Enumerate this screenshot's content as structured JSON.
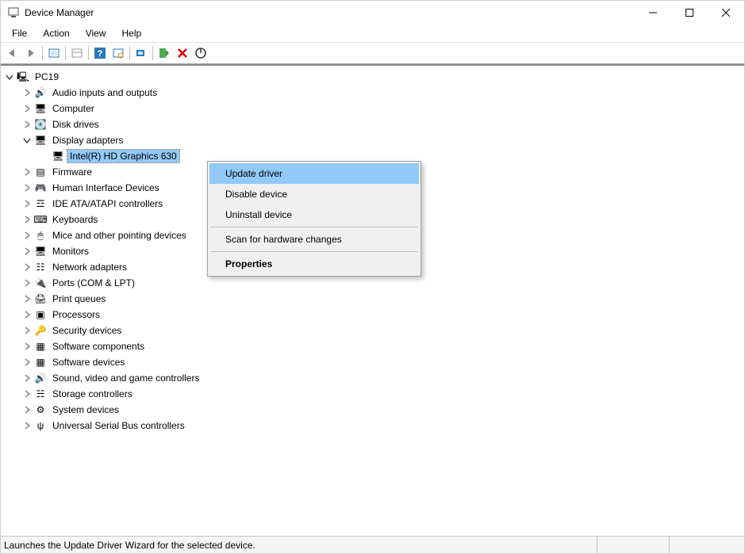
{
  "window": {
    "title": "Device Manager"
  },
  "menus": {
    "file": "File",
    "action": "Action",
    "view": "View",
    "help": "Help"
  },
  "tree": {
    "root": "PC19",
    "categories": [
      {
        "label": "Audio inputs and outputs",
        "icon": "speaker",
        "expanded": false
      },
      {
        "label": "Computer",
        "icon": "monitor",
        "expanded": false
      },
      {
        "label": "Disk drives",
        "icon": "disk",
        "expanded": false
      },
      {
        "label": "Display adapters",
        "icon": "monitor",
        "expanded": true,
        "children": [
          {
            "label": "Intel(R) HD Graphics 630",
            "icon": "monitor",
            "selected": true
          }
        ]
      },
      {
        "label": "Firmware",
        "icon": "chip",
        "expanded": false
      },
      {
        "label": "Human Interface Devices",
        "icon": "hid",
        "expanded": false
      },
      {
        "label": "IDE ATA/ATAPI controllers",
        "icon": "ide",
        "expanded": false
      },
      {
        "label": "Keyboards",
        "icon": "keyboard",
        "expanded": false
      },
      {
        "label": "Mice and other pointing devices",
        "icon": "mouse",
        "expanded": false
      },
      {
        "label": "Monitors",
        "icon": "monitor",
        "expanded": false
      },
      {
        "label": "Network adapters",
        "icon": "network",
        "expanded": false
      },
      {
        "label": "Ports (COM & LPT)",
        "icon": "port",
        "expanded": false
      },
      {
        "label": "Print queues",
        "icon": "printer",
        "expanded": false
      },
      {
        "label": "Processors",
        "icon": "cpu",
        "expanded": false
      },
      {
        "label": "Security devices",
        "icon": "security",
        "expanded": false
      },
      {
        "label": "Software components",
        "icon": "software",
        "expanded": false
      },
      {
        "label": "Software devices",
        "icon": "software",
        "expanded": false
      },
      {
        "label": "Sound, video and game controllers",
        "icon": "speaker",
        "expanded": false
      },
      {
        "label": "Storage controllers",
        "icon": "storage",
        "expanded": false
      },
      {
        "label": "System devices",
        "icon": "system",
        "expanded": false
      },
      {
        "label": "Universal Serial Bus controllers",
        "icon": "usb",
        "expanded": false
      }
    ]
  },
  "context_menu": {
    "update": "Update driver",
    "disable": "Disable device",
    "uninstall": "Uninstall device",
    "scan": "Scan for hardware changes",
    "properties": "Properties"
  },
  "statusbar": {
    "text": "Launches the Update Driver Wizard for the selected device."
  },
  "icons": {
    "speaker": "🔊",
    "monitor": "🖥",
    "disk": "💽",
    "chip": "▤",
    "hid": "🎮",
    "ide": "☲",
    "keyboard": "⌨",
    "mouse": "🖱",
    "network": "☷",
    "port": "🔌",
    "printer": "🖨",
    "cpu": "▣",
    "security": "🔑",
    "software": "▦",
    "storage": "☵",
    "system": "⚙",
    "usb": "ψ",
    "pc": "🖳"
  }
}
